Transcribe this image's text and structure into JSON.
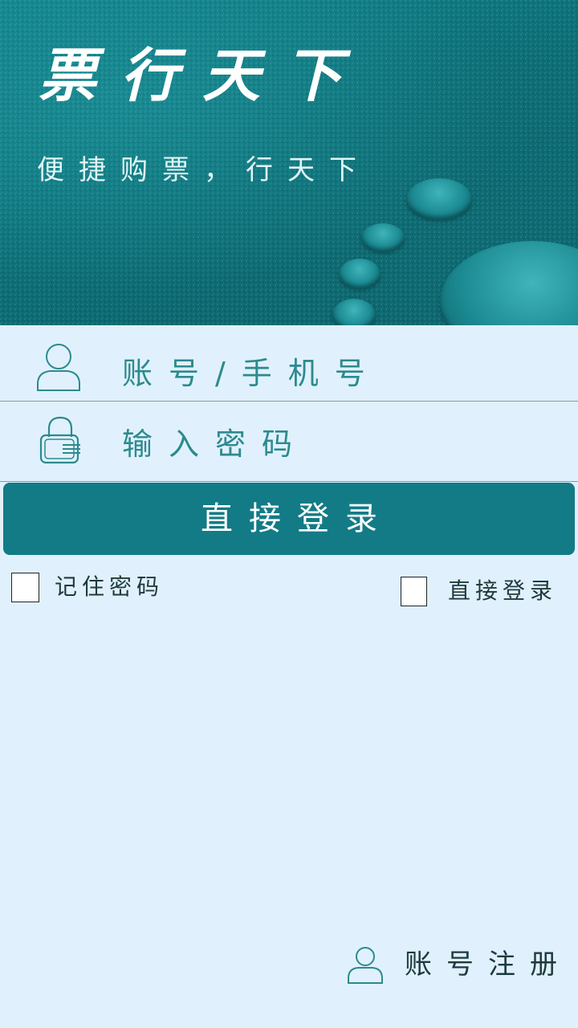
{
  "banner": {
    "title": "票行天下",
    "slogan": "便捷购票，行天下"
  },
  "form": {
    "account_placeholder": "账号/手机号",
    "password_placeholder": "输入密码",
    "login_button": "直接登录"
  },
  "options": {
    "remember_password": {
      "label": "记住密码",
      "checked": false
    },
    "auto_login": {
      "label": "直接登录",
      "checked": false
    }
  },
  "footer": {
    "register_label": "账号注册"
  },
  "icons": {
    "account": "user-icon",
    "password": "lock-icon",
    "register": "user-icon"
  },
  "colors": {
    "page_background": "#e0f1fd",
    "banner": "#0e7078",
    "primary_button": "#137b86",
    "input_text": "#2d8a8e",
    "icon_stroke": "#2d8a8e"
  }
}
